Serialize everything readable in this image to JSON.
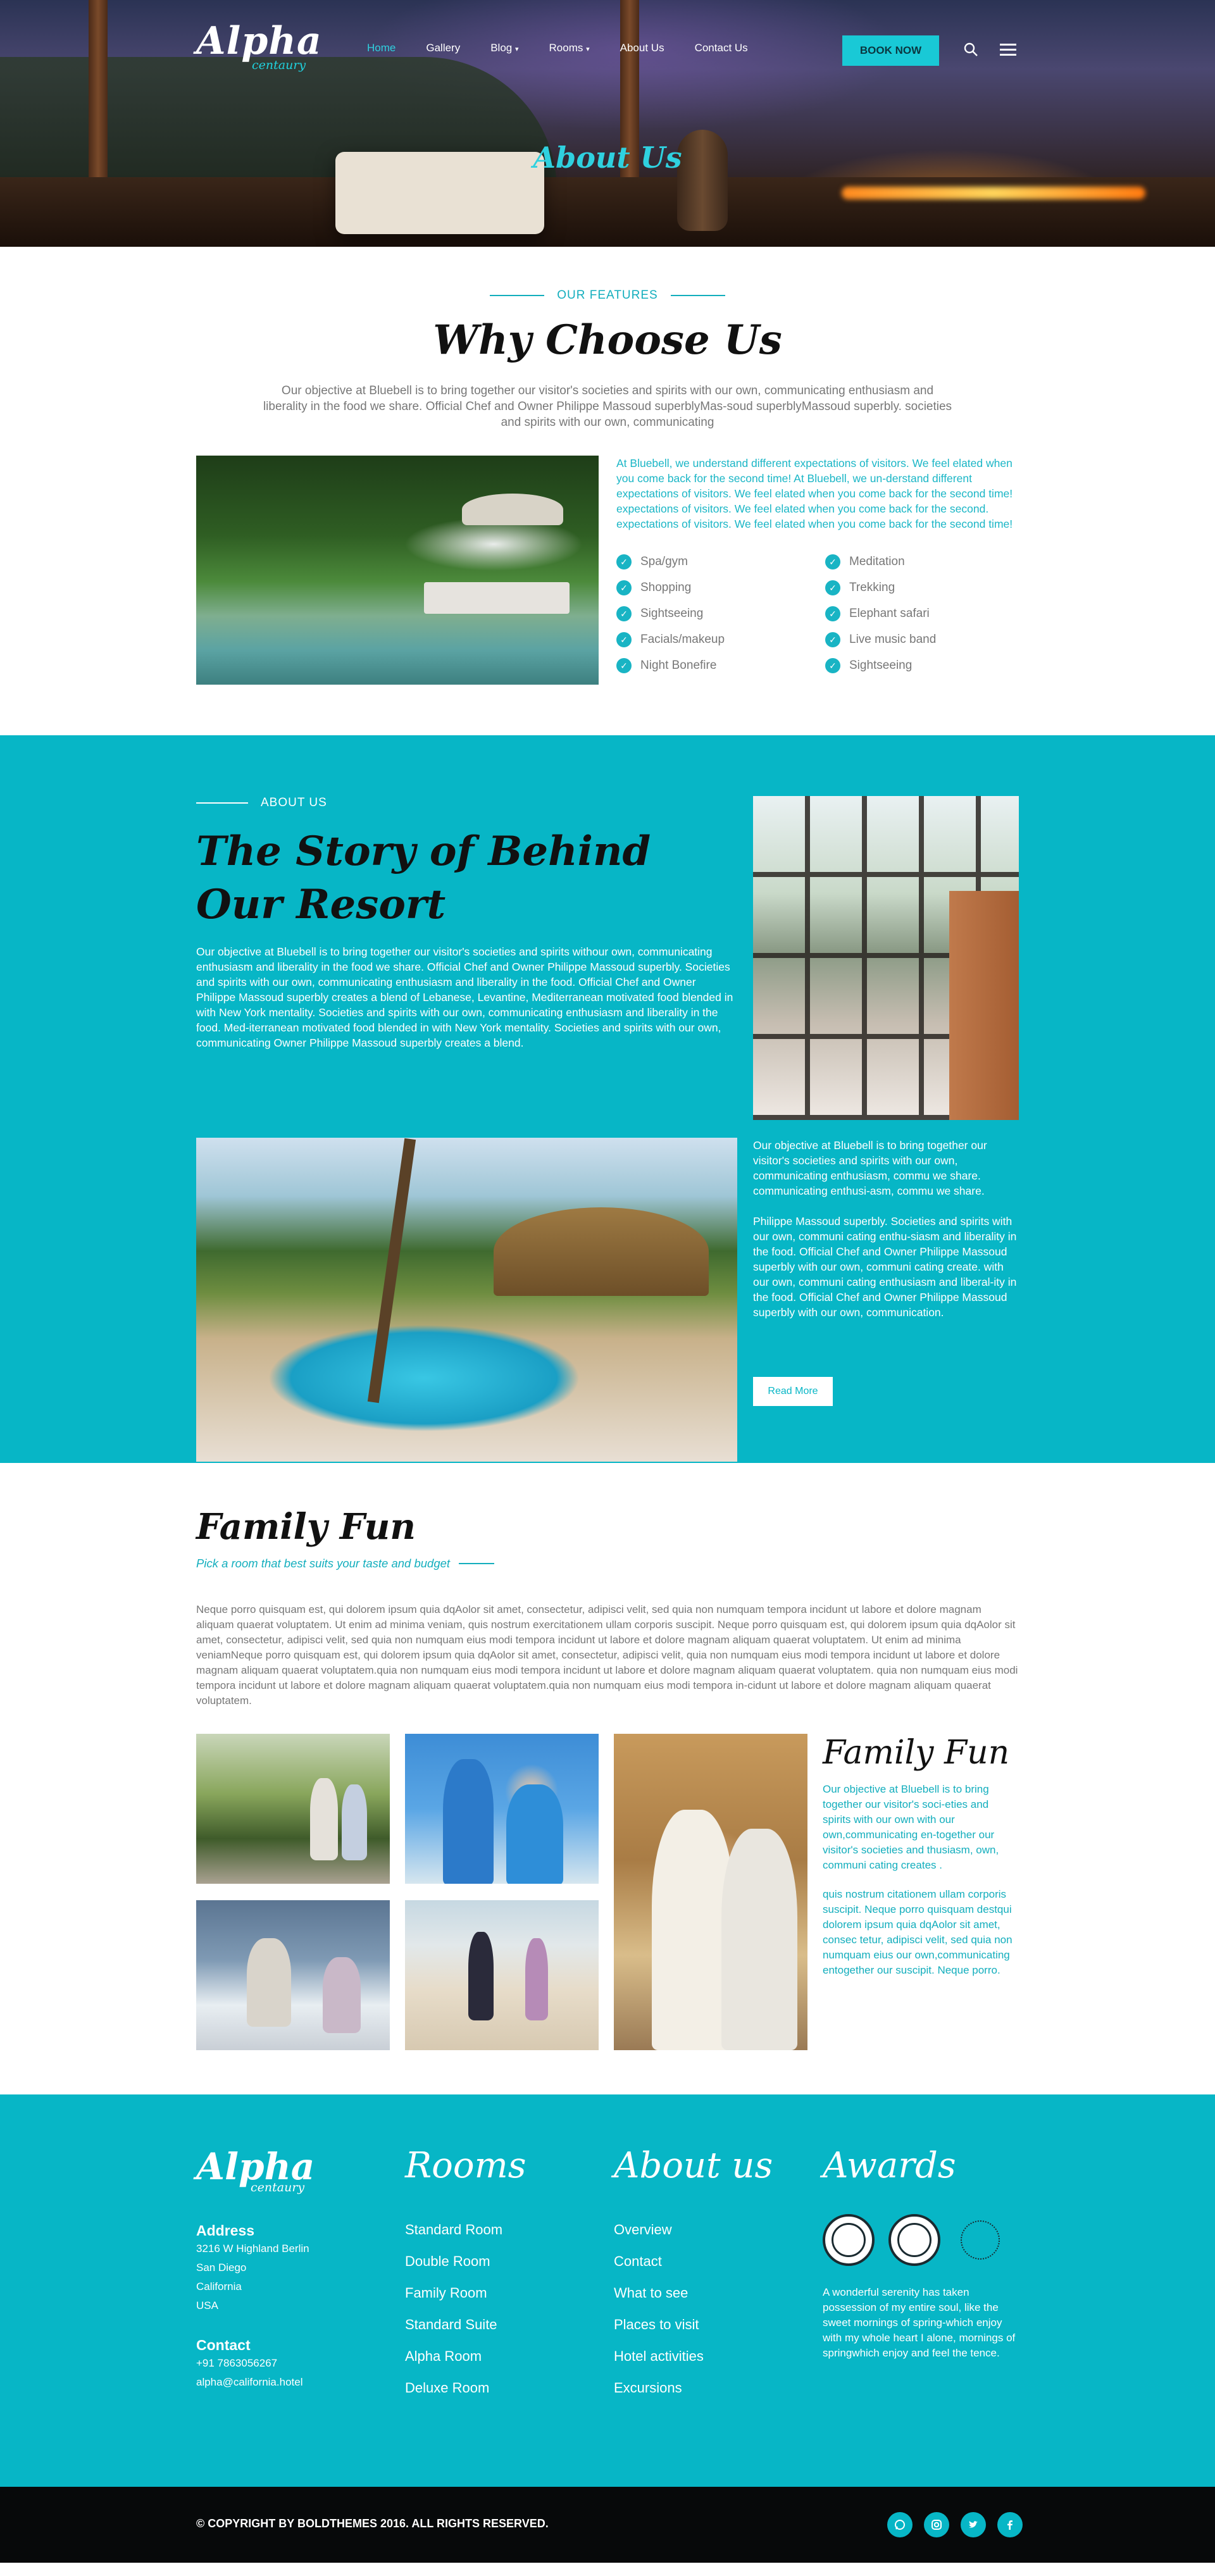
{
  "logo": {
    "main": "Alpha",
    "sub": "centaury"
  },
  "nav": {
    "items": [
      {
        "label": "Home",
        "caret": ""
      },
      {
        "label": "Gallery",
        "caret": ""
      },
      {
        "label": "Blog",
        "caret": "▾"
      },
      {
        "label": "Rooms",
        "caret": "▾"
      },
      {
        "label": "About Us",
        "caret": ""
      },
      {
        "label": "Contact Us",
        "caret": ""
      }
    ],
    "book_label": "BOOK NOW",
    "search_icon": "search-icon",
    "menu_icon": "hamburger-icon"
  },
  "hero": {
    "title": "About Us"
  },
  "features": {
    "kicker": "OUR FEATURES",
    "title": "Why Choose Us",
    "intro": "Our objective at Bluebell is to bring together our visitor's societies and spirits with our own, communicating enthusiasm and liberality in the food we share. Official Chef and Owner Philippe Massoud superblyMas-soud superblyMassoud superbly. societies and spirits with our own, communicating",
    "text": "At Bluebell, we understand different expectations of visitors. We feel elated when you come back for the second time! At Bluebell, we un-derstand different expectations of visitors. We feel elated when you come back for the second time! expectations of visitors. We feel elated when you come back for the second. expectations of visitors. We feel elated when you come back for the second time!",
    "checks": [
      "Spa/gym",
      "Meditation",
      "Shopping",
      "Trekking",
      "Sightseeing",
      "Elephant safari",
      "Facials/makeup",
      "Live music band",
      "Night Bonefire",
      "Sightseeing"
    ]
  },
  "about": {
    "kicker": "ABOUT US",
    "title_line1": "The Story of Behind",
    "title_line2": "Our Resort",
    "paragraph": "Our objective at Bluebell is to bring together our visitor's societies and spirits withour own, communicating enthusiasm and liberality in the food we share. Official Chef and Owner Philippe Massoud superbly. Societies and spirits with our own, communicating enthusiasm and liberality in the food. Official Chef and Owner Philippe Massoud superbly creates a blend of Lebanese, Levantine, Mediterranean motivated food blended in with New York mentality. Societies and spirits with our own, communicating enthusiasm and liberality in the food. Med-iterranean motivated food blended in with New York mentality. Societies and spirits with our own, communicating Owner Philippe Massoud superbly creates a blend.",
    "side_p1": "Our objective at Bluebell is to bring together our visitor's societies and spirits with our own, communicating enthusiasm, commu we share. communicating enthusi-asm, commu we share.",
    "side_p2": "Philippe Massoud superbly. Societies and spirits with our own, communi cating enthu-siasm and liberality in the food. Official Chef and Owner Philippe Massoud superbly with our own, communi cating create. with our own, communi cating enthusiasm and liberal-ity in the food. Official Chef and Owner Philippe Massoud superbly with our own, communication.",
    "read_more": "Read More"
  },
  "family": {
    "title": "Family Fun",
    "subtitle": "Pick a room that best suits your taste and budget",
    "paragraph": "Neque porro quisquam est, qui dolorem ipsum quia dqAolor sit amet, consectetur, adipisci velit, sed quia non numquam tempora incidunt ut labore et dolore magnam aliquam quaerat voluptatem. Ut enim ad minima veniam, quis nostrum exercitationem ullam corporis suscipit. Neque porro quisquam est, qui dolorem ipsum quia dqAolor sit amet, consectetur, adipisci velit, sed quia non numquam eius modi tempora incidunt ut labore et dolore magnam aliquam quaerat voluptatem. Ut enim ad minima veniamNeque porro quisquam est, qui dolorem ipsum quia dqAolor sit amet, consectetur, adipisci velit, quia non numquam eius modi tempora incidunt ut labore et dolore magnam aliquam quaerat voluptatem.quia non numquam eius modi tempora incidunt ut labore et dolore magnam aliquam quaerat voluptatem. quia non numquam eius modi tempora incidunt ut labore et dolore magnam aliquam quaerat voluptatem.quia non numquam eius modi tempora in-cidunt ut labore et dolore magnam aliquam quaerat voluptatem.",
    "side_title": "Family Fun",
    "side_p1": "Our objective at Bluebell is to bring together our visitor's soci-eties and spirits with our own with our own,communicating en-together our visitor's societies and thusiasm, own, communi cating creates .",
    "side_p2": "quis nostrum citationem ullam corporis suscipit. Neque porro quisquam destqui dolorem ipsum quia dqAolor sit amet, consec tetur, adipisci velit, sed quia non numquam eius our own,communicating entogether our suscipit. Neque porro."
  },
  "footer": {
    "logo_main": "Alpha",
    "logo_sub": "centaury",
    "address_title": "Address",
    "address_lines": [
      "3216 W Highland Berlin",
      "San Diego",
      "California",
      "USA"
    ],
    "contact_title": "Contact",
    "contact_lines": [
      "+91 7863056267",
      "alpha@california.hotel"
    ],
    "rooms_title": "Rooms",
    "rooms": [
      "Standard Room",
      "Double Room",
      "Family Room",
      "Standard Suite",
      "Alpha Room",
      "Deluxe Room"
    ],
    "about_title": "About us",
    "about_links": [
      "Overview",
      "Contact",
      "What to see",
      "Places to visit",
      "Hotel activities",
      "Excursions"
    ],
    "awards_title": "Awards",
    "awards_text": "A wonderful serenity has taken possession of my entire soul, like the sweet mornings of spring-which enjoy with my whole heart I alone, mornings of springwhich enjoy and feel the tence.",
    "copyright": "© COPYRIGHT BY BOLDTHEMES 2016. ALL RIGHTS RESERVED.",
    "socials": [
      "whatsapp-icon",
      "instagram-icon",
      "twitter-icon",
      "facebook-icon"
    ]
  },
  "colors": {
    "accent": "#07b6c6",
    "accent_text": "#13aebd",
    "dark": "#07090a"
  }
}
